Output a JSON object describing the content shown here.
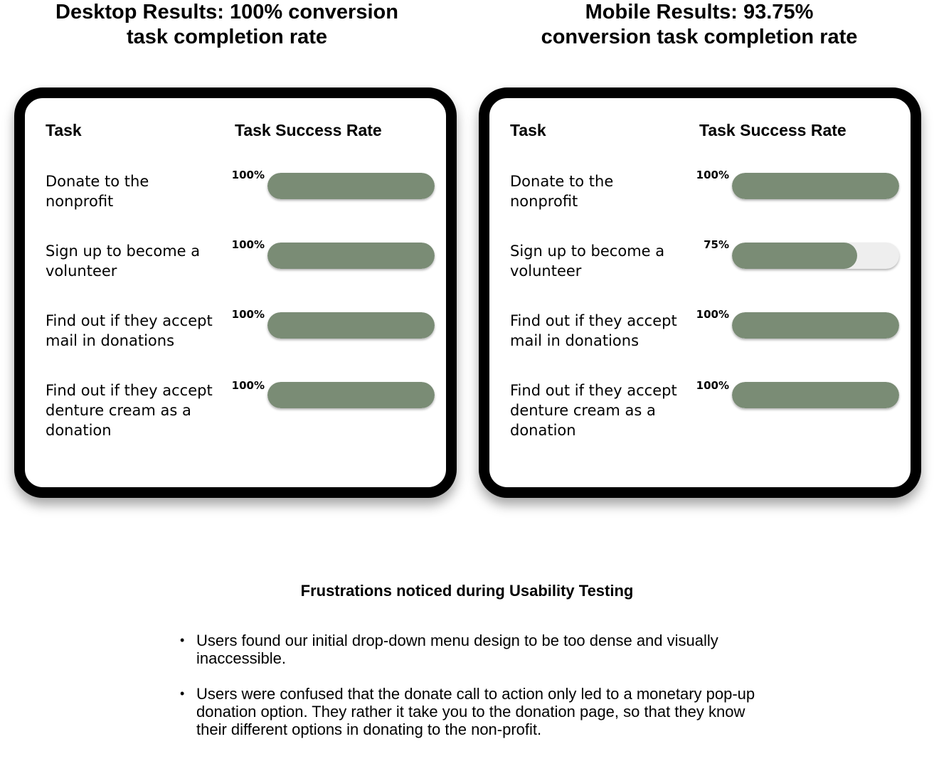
{
  "desktop": {
    "title_lines": [
      "Desktop Results: 100% conversion",
      "task completion rate"
    ],
    "header_task": "Task",
    "header_rate": "Task Success Rate",
    "rows": [
      {
        "task_lines": [
          "Donate to the",
          "nonprofit"
        ],
        "pct_label": "100%",
        "fill": 1.0
      },
      {
        "task_lines": [
          "Sign up to become a",
          "volunteer"
        ],
        "pct_label": "100%",
        "fill": 1.0
      },
      {
        "task_lines": [
          "Find out if they accept",
          "mail in donations"
        ],
        "pct_label": "100%",
        "fill": 1.0
      },
      {
        "task_lines": [
          "Find out if they accept",
          "denture cream as a",
          "donation"
        ],
        "pct_label": "100%",
        "fill": 1.0
      }
    ]
  },
  "mobile": {
    "title_lines": [
      "Mobile Results: 93.75%",
      "conversion task completion rate"
    ],
    "header_task": "Task",
    "header_rate": "Task Success Rate",
    "rows": [
      {
        "task_lines": [
          "Donate to the",
          "nonprofit"
        ],
        "pct_label": "100%",
        "fill": 1.0
      },
      {
        "task_lines": [
          "Sign up to become a",
          "volunteer"
        ],
        "pct_label": "75%",
        "fill": 0.75
      },
      {
        "task_lines": [
          "Find out if they accept",
          "mail in donations"
        ],
        "pct_label": "100%",
        "fill": 1.0
      },
      {
        "task_lines": [
          "Find out if they accept",
          "denture cream as a",
          "donation"
        ],
        "pct_label": "100%",
        "fill": 1.0
      }
    ]
  },
  "frustrations": {
    "title": "Frustrations noticed during Usability Testing",
    "items": [
      "Users found our initial drop-down menu design to be too dense and visually inaccessible.",
      "Users were confused that the donate call to action only led to a monetary pop-up donation option.  They rather it take you to the donation page, so that they know their different options in donating to the non-profit."
    ]
  },
  "colors": {
    "bar_fill": "#7a8c75",
    "bar_track": "#eeeeee",
    "card_border": "#000000"
  }
}
